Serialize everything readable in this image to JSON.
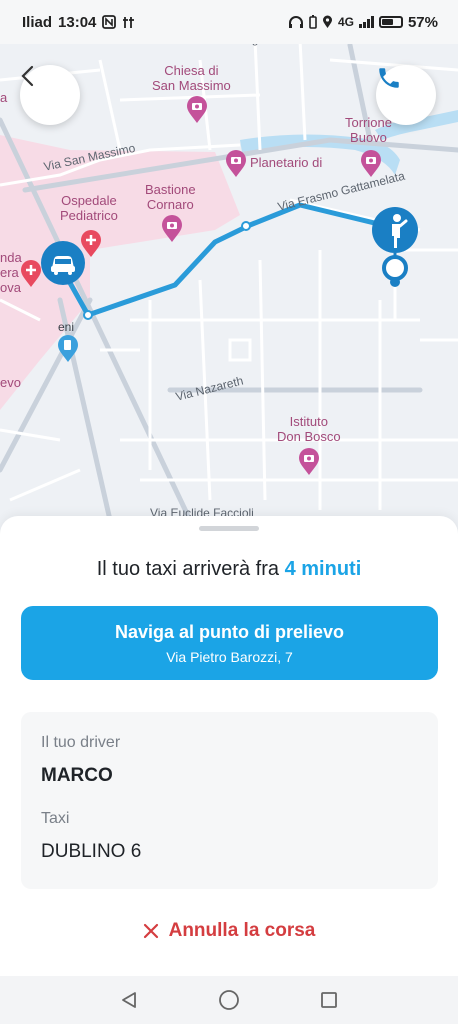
{
  "status_bar": {
    "carrier": "Iliad",
    "time": "13:04",
    "network": "4G",
    "battery": "57%",
    "icons": [
      "nfc-icon",
      "signal-alt-icon",
      "headphones-icon",
      "battery-saver-icon",
      "location-icon",
      "signal-icon",
      "battery-icon"
    ]
  },
  "map": {
    "streets": {
      "via_ognissanti": "Via Ognissanti",
      "via_san_massimo": "Via San Massimo",
      "via_erasmo": "Via Erasmo Gattamelata",
      "via_nazareth": "Via Nazareth",
      "via_bottom": "Via Euclide Faccioli"
    },
    "pois": {
      "chiesa_line1": "Chiesa di",
      "chiesa_line2": "San Massimo",
      "torrione_line1": "Torrione",
      "torrione_line2": "Buovo",
      "planetario": "Planetario di",
      "ospedale_line1": "Ospedale",
      "ospedale_line2": "Pediatrico",
      "bastione_line1": "Bastione",
      "bastione_line2": "Cornaro",
      "istituto_line1": "Istituto",
      "istituto_line2": "Don Bosco",
      "left_line1": "nda",
      "left_line2": "era",
      "left_line3": "ova",
      "eni": "eni",
      "evo": "evo",
      "a_left": "a"
    },
    "colors": {
      "route": "#2a9bd9",
      "hospital_zone": "#f7dbe6",
      "river": "#9fd3f0",
      "poi": "#c4529a",
      "hospital_pin": "#e84a5f",
      "marker": "#1a7fc4"
    }
  },
  "buttons": {
    "back_icon": "chevron-left-icon",
    "call_icon": "phone-icon"
  },
  "sheet": {
    "eta_prefix": "Il tuo taxi arriverà fra ",
    "eta_value": "4 minuti",
    "nav_title": "Naviga al punto di prelievo",
    "nav_subtitle": "Via Pietro Barozzi, 7",
    "driver_label": "Il tuo driver",
    "driver_name": "MARCO",
    "taxi_label": "Taxi",
    "taxi_id": "DUBLINO 6",
    "cancel_label": "Annulla la corsa",
    "accent": "#1ba4e6",
    "danger": "#d43d40"
  },
  "system_nav": {
    "back": "triangle-back-icon",
    "home": "circle-home-icon",
    "recents": "square-recents-icon"
  }
}
